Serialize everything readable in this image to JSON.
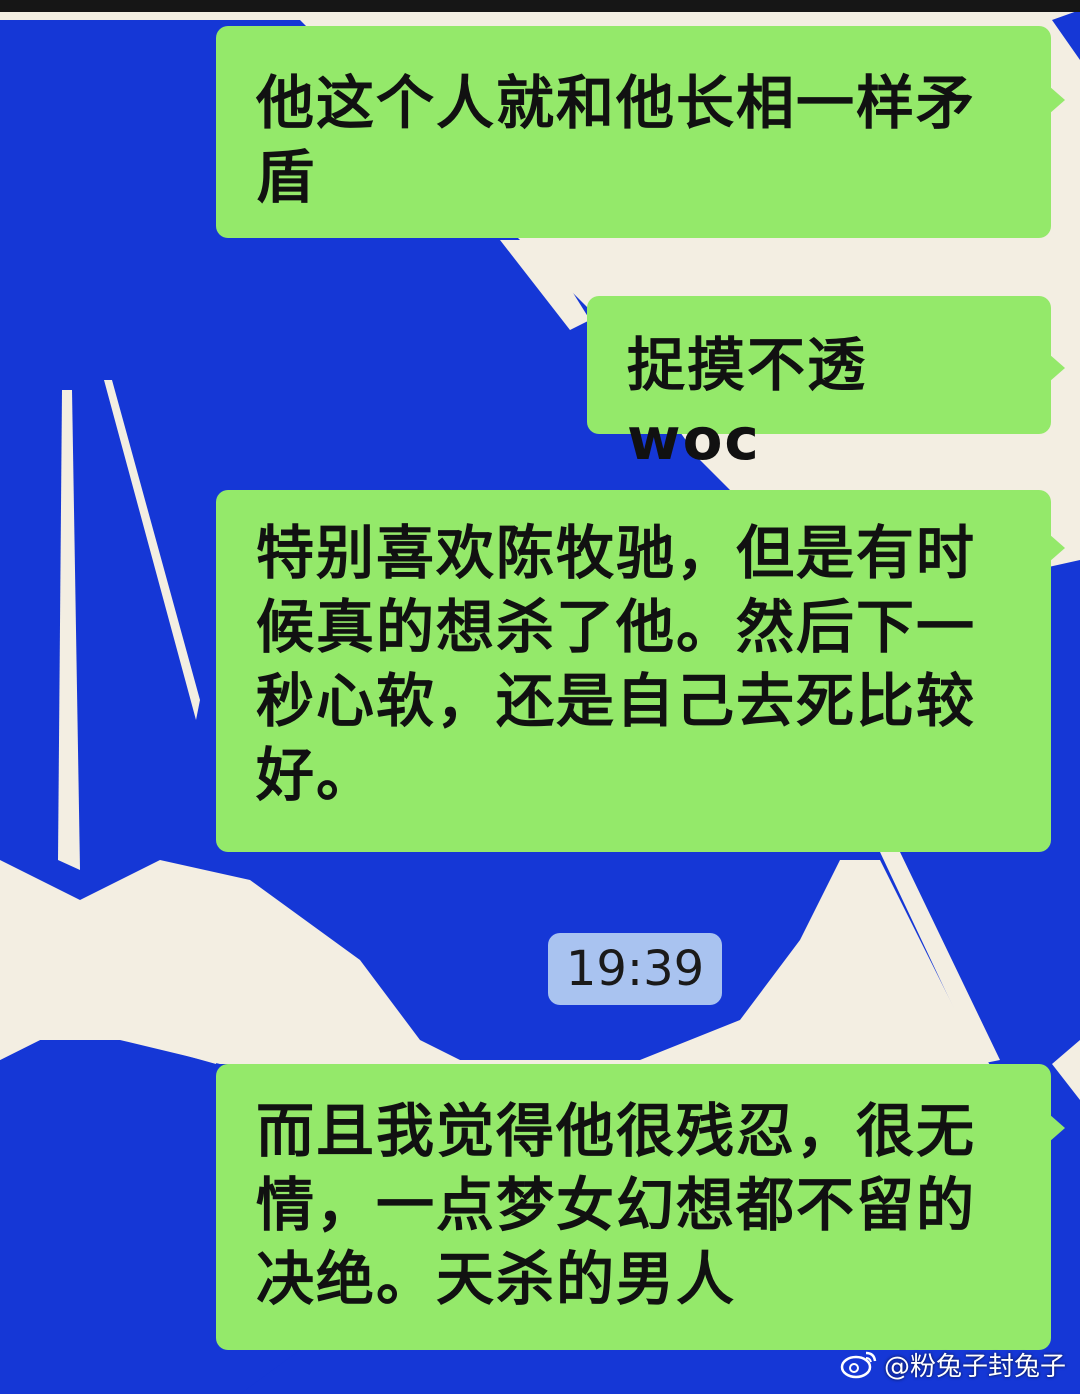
{
  "messages": [
    {
      "id": "b1",
      "text": "他这个人就和他长相一样矛\n盾"
    },
    {
      "id": "b2",
      "text": "捉摸不透 woc"
    },
    {
      "id": "b3",
      "text": "特别喜欢陈牧驰，但是有时\n候真的想杀了他。然后下一\n秒心软，还是自己去死比较\n好。"
    },
    {
      "id": "b4",
      "text": "而且我觉得他很残忍，很无\n情，一点梦女幻想都不留的\n决绝。天杀的男人"
    }
  ],
  "timestamp": "19:39",
  "watermark": {
    "text": "@粉兔子封兔子",
    "icon": "weibo-logo-icon"
  },
  "colors": {
    "bubble": "#94e96a",
    "background_art": "#1537d6",
    "background_paper": "#f3eee2",
    "timestamp_bg": "#a9c3f0"
  }
}
